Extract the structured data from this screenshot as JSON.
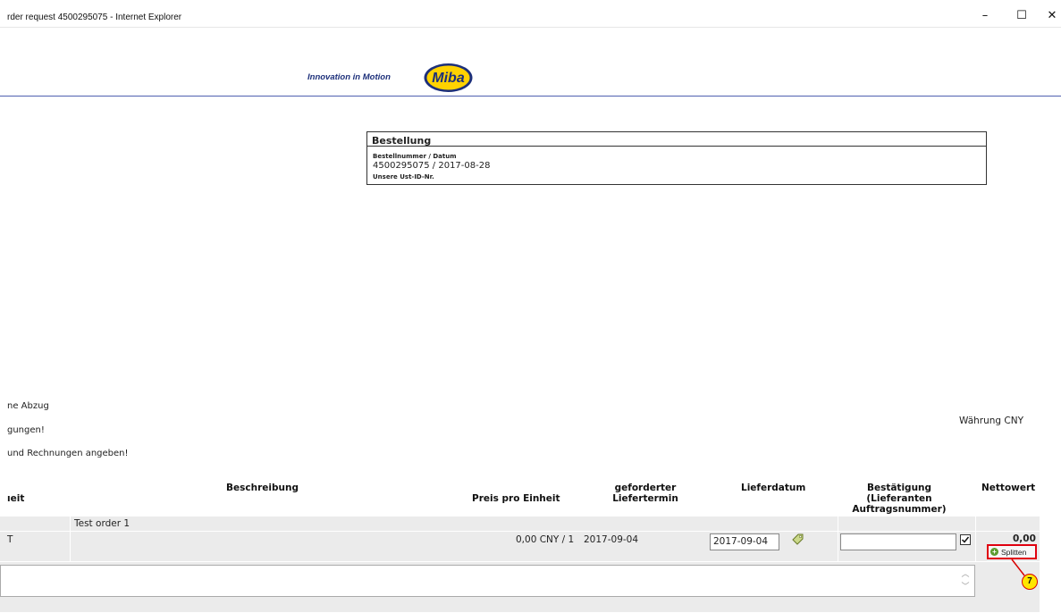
{
  "window": {
    "title": "rder request 4500295075 - Internet Explorer",
    "minimize_glyph": "–",
    "maximize_glyph": "☐",
    "close_glyph": "✕"
  },
  "header": {
    "tagline": "Innovation in Motion",
    "logo_text": "Miba",
    "brand_color": "#1c2f7a",
    "logo_accent": "#ffd200"
  },
  "order_box": {
    "title": "Bestellung",
    "number_date_label": "Bestellnummer / Datum",
    "number_date_value": "4500295075 / 2017-08-28",
    "vat_label": "Unsere Ust-ID-Nr."
  },
  "notes": [
    "ne Abzug",
    "gungen!",
    " und Rechnungen angeben!"
  ],
  "currency": "Währung CNY",
  "table": {
    "headers": {
      "unit": "ıeit",
      "description": "Beschreibung",
      "price": "Preis pro Einheit",
      "requested_line1": "geforderter",
      "requested_line2": "Liefertermin",
      "delivery": "Lieferdatum",
      "confirm_line1": "Bestätigung",
      "confirm_line2": "(Lieferanten",
      "confirm_line3": "Auftragsnummer)",
      "net": "Nettowert"
    },
    "row": {
      "description": "Test order 1",
      "unit": "T",
      "price": "0,00 CNY  / 1",
      "requested_date": "2017-09-04",
      "delivery_date": "2017-09-04",
      "confirmation_value": "",
      "net_value": "0,00",
      "split_label": "Splitten",
      "callout": "7"
    }
  },
  "icons": {
    "calendar": "calendar-picker-icon",
    "checkbox": "checkbox-icon",
    "split": "add-circle-icon"
  }
}
